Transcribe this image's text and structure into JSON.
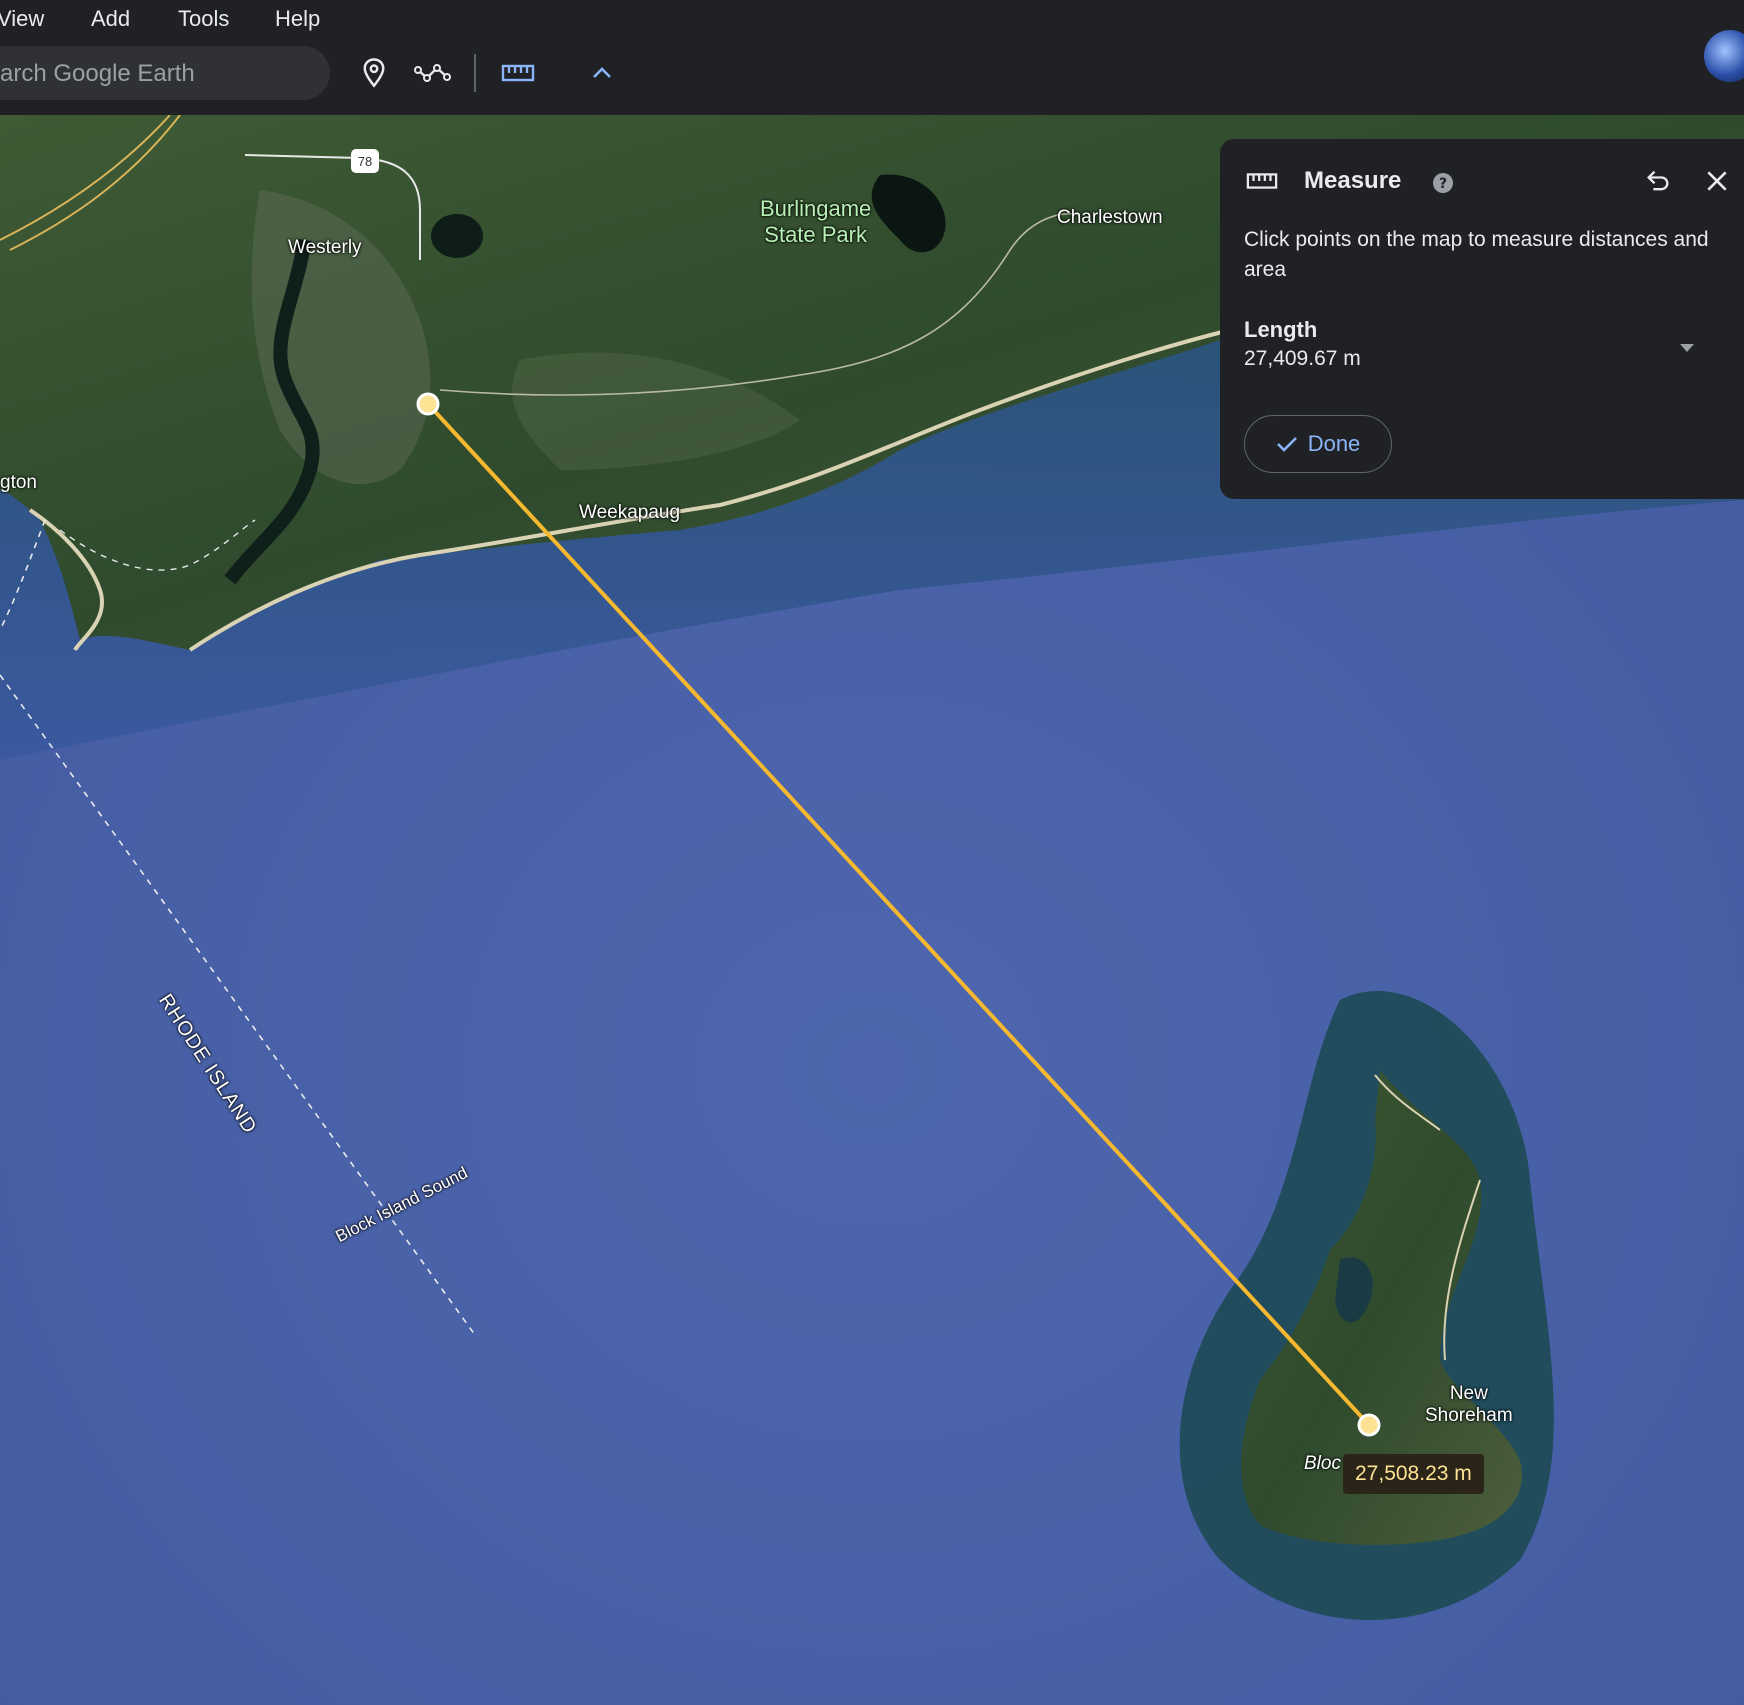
{
  "menu": {
    "items": [
      {
        "label": "View"
      },
      {
        "label": "Add"
      },
      {
        "label": "Tools"
      },
      {
        "label": "Help"
      }
    ]
  },
  "search": {
    "placeholder": "arch Google Earth"
  },
  "map": {
    "labels": {
      "westerly": "Westerly",
      "route": "78",
      "burlingame": "Burlingame\nState Park",
      "charlestown": "Charlestown",
      "weekapaug": "Weekapaug",
      "gton": "gton",
      "rhode_island": "RHODE ISLAND",
      "block_island_sound": "Block Island Sound",
      "new_shoreham": "New\nShoreham",
      "bloc": "Bloc"
    },
    "segment_tooltip": "27,508.23 m",
    "line_color": "#f5b82e"
  },
  "measure": {
    "title": "Measure",
    "description": "Click points on the map to measure distances and area",
    "length_label": "Length",
    "length_value": "27,409.67 m",
    "done_label": "Done"
  },
  "colors": {
    "accent": "#8ab4f8",
    "panel_bg": "#202124",
    "toolbar_bg": "#202124"
  }
}
